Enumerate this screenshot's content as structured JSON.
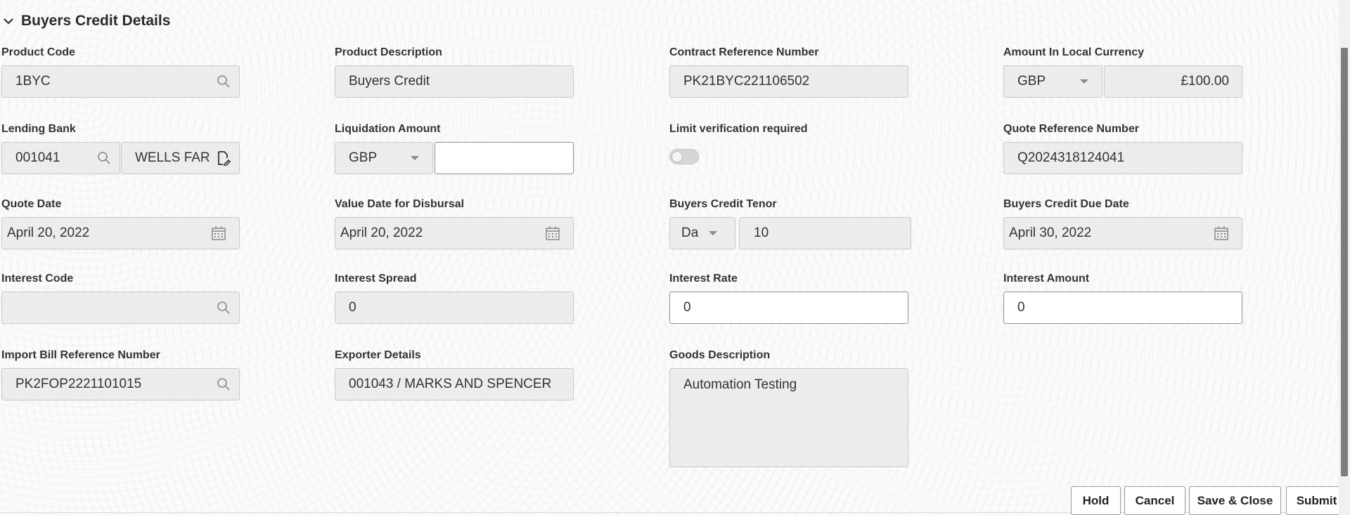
{
  "section": {
    "title": "Buyers Credit Details"
  },
  "fields": {
    "product_code": {
      "label": "Product Code",
      "value": "1BYC"
    },
    "product_description": {
      "label": "Product Description",
      "value": "Buyers Credit"
    },
    "contract_reference_number": {
      "label": "Contract Reference Number",
      "value": "PK21BYC221106502"
    },
    "amount_local_currency": {
      "label": "Amount In Local Currency",
      "currency": "GBP",
      "amount": "£100.00"
    },
    "lending_bank": {
      "label": "Lending Bank",
      "code": "001041",
      "name": "WELLS FAR"
    },
    "liquidation_amount": {
      "label": "Liquidation Amount",
      "currency": "GBP",
      "amount": ""
    },
    "limit_verification": {
      "label": "Limit verification required",
      "enabled": false
    },
    "quote_reference_number": {
      "label": "Quote Reference Number",
      "value": "Q2024318124041"
    },
    "quote_date": {
      "label": "Quote Date",
      "value": "April 20, 2022"
    },
    "value_date_disbursal": {
      "label": "Value Date for Disbursal",
      "value": "April 20, 2022"
    },
    "buyers_credit_tenor": {
      "label": "Buyers Credit Tenor",
      "unit": "Da",
      "value": "10"
    },
    "buyers_credit_due_date": {
      "label": "Buyers Credit Due Date",
      "value": "April 30, 2022"
    },
    "interest_code": {
      "label": "Interest Code",
      "value": ""
    },
    "interest_spread": {
      "label": "Interest Spread",
      "value": "0"
    },
    "interest_rate": {
      "label": "Interest Rate",
      "value": "0"
    },
    "interest_amount": {
      "label": "Interest Amount",
      "value": "0"
    },
    "import_bill_reference_number": {
      "label": "Import Bill Reference Number",
      "value": "PK2FOP2221101015"
    },
    "exporter_details": {
      "label": "Exporter Details",
      "value": "001043 / MARKS AND SPENCER"
    },
    "goods_description": {
      "label": "Goods Description",
      "value": "Automation Testing"
    }
  },
  "buttons": {
    "hold": "Hold",
    "cancel": "Cancel",
    "save_close": "Save & Close",
    "submit": "Submit"
  },
  "icons": [
    "chevron-down-icon",
    "search-icon",
    "caret-down-icon",
    "document-edit-icon",
    "calendar-icon"
  ],
  "colors": {
    "input_bg": "#eaeaea",
    "border": "#c9c9c9",
    "active_border": "#8f8f8f",
    "text": "#333333"
  }
}
